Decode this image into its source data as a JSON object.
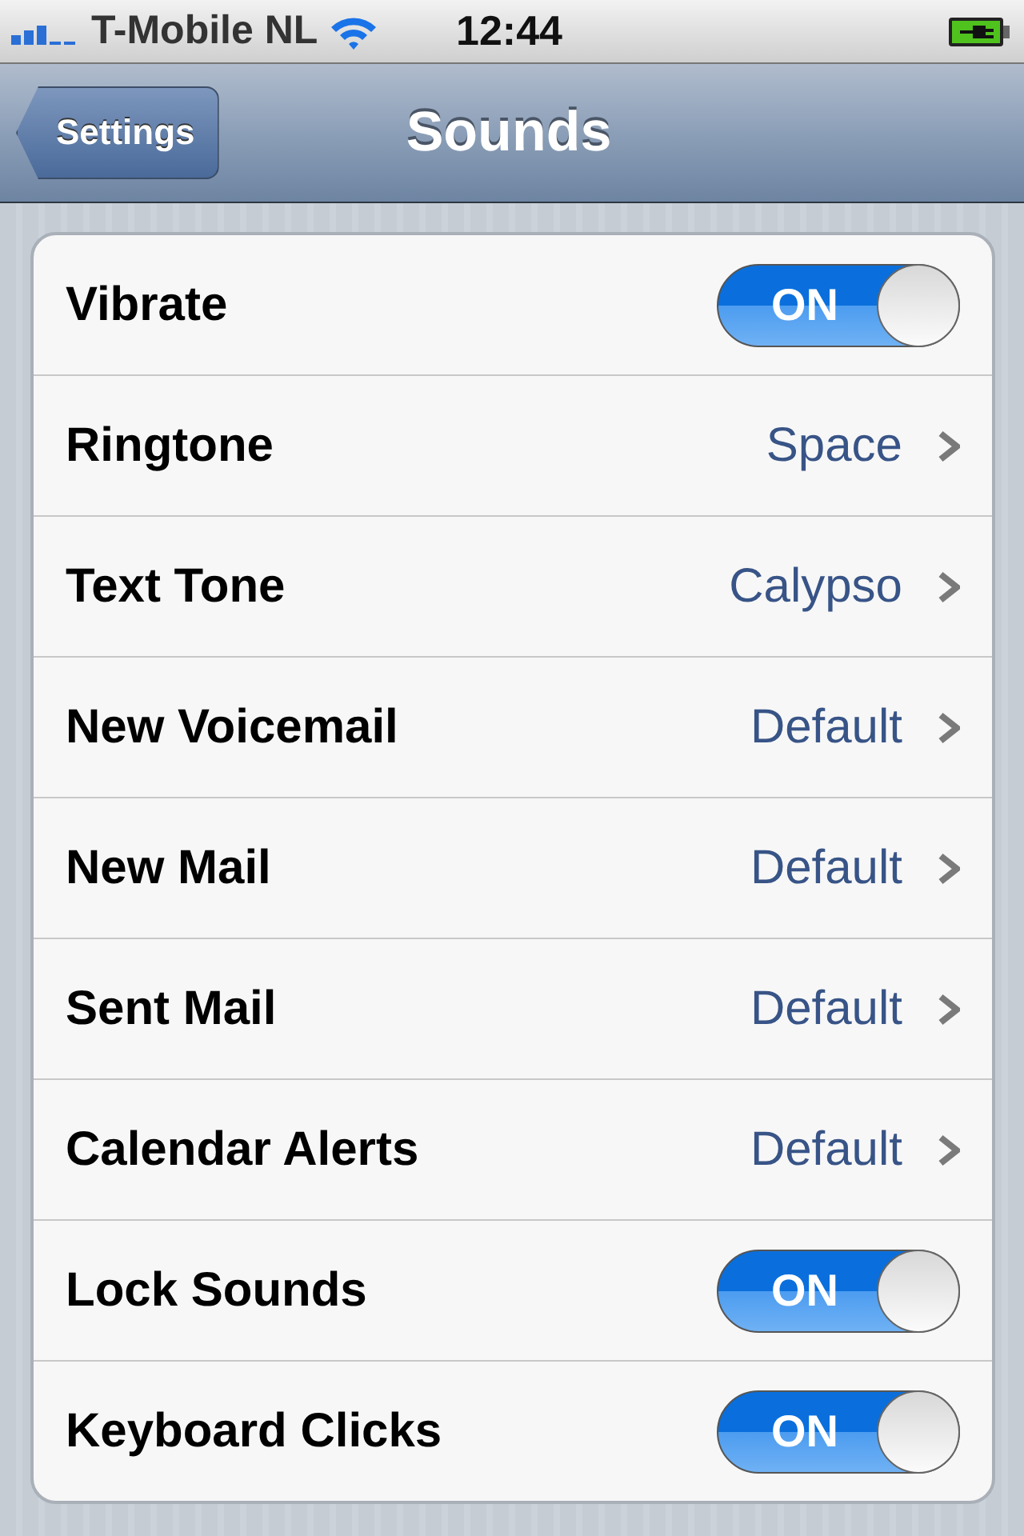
{
  "status_bar": {
    "carrier": "T-Mobile NL",
    "time": "12:44"
  },
  "nav_bar": {
    "back_button": "Settings",
    "title": "Sounds"
  },
  "rows": [
    {
      "kind": "toggle",
      "label": "Vibrate",
      "on": true,
      "switch_text": "ON"
    },
    {
      "kind": "link",
      "label": "Ringtone",
      "value": "Space"
    },
    {
      "kind": "link",
      "label": "Text Tone",
      "value": "Calypso"
    },
    {
      "kind": "link",
      "label": "New Voicemail",
      "value": "Default"
    },
    {
      "kind": "link",
      "label": "New Mail",
      "value": "Default"
    },
    {
      "kind": "link",
      "label": "Sent Mail",
      "value": "Default"
    },
    {
      "kind": "link",
      "label": "Calendar Alerts",
      "value": "Default"
    },
    {
      "kind": "toggle",
      "label": "Lock Sounds",
      "on": true,
      "switch_text": "ON"
    },
    {
      "kind": "toggle",
      "label": "Keyboard Clicks",
      "on": true,
      "switch_text": "ON"
    }
  ]
}
